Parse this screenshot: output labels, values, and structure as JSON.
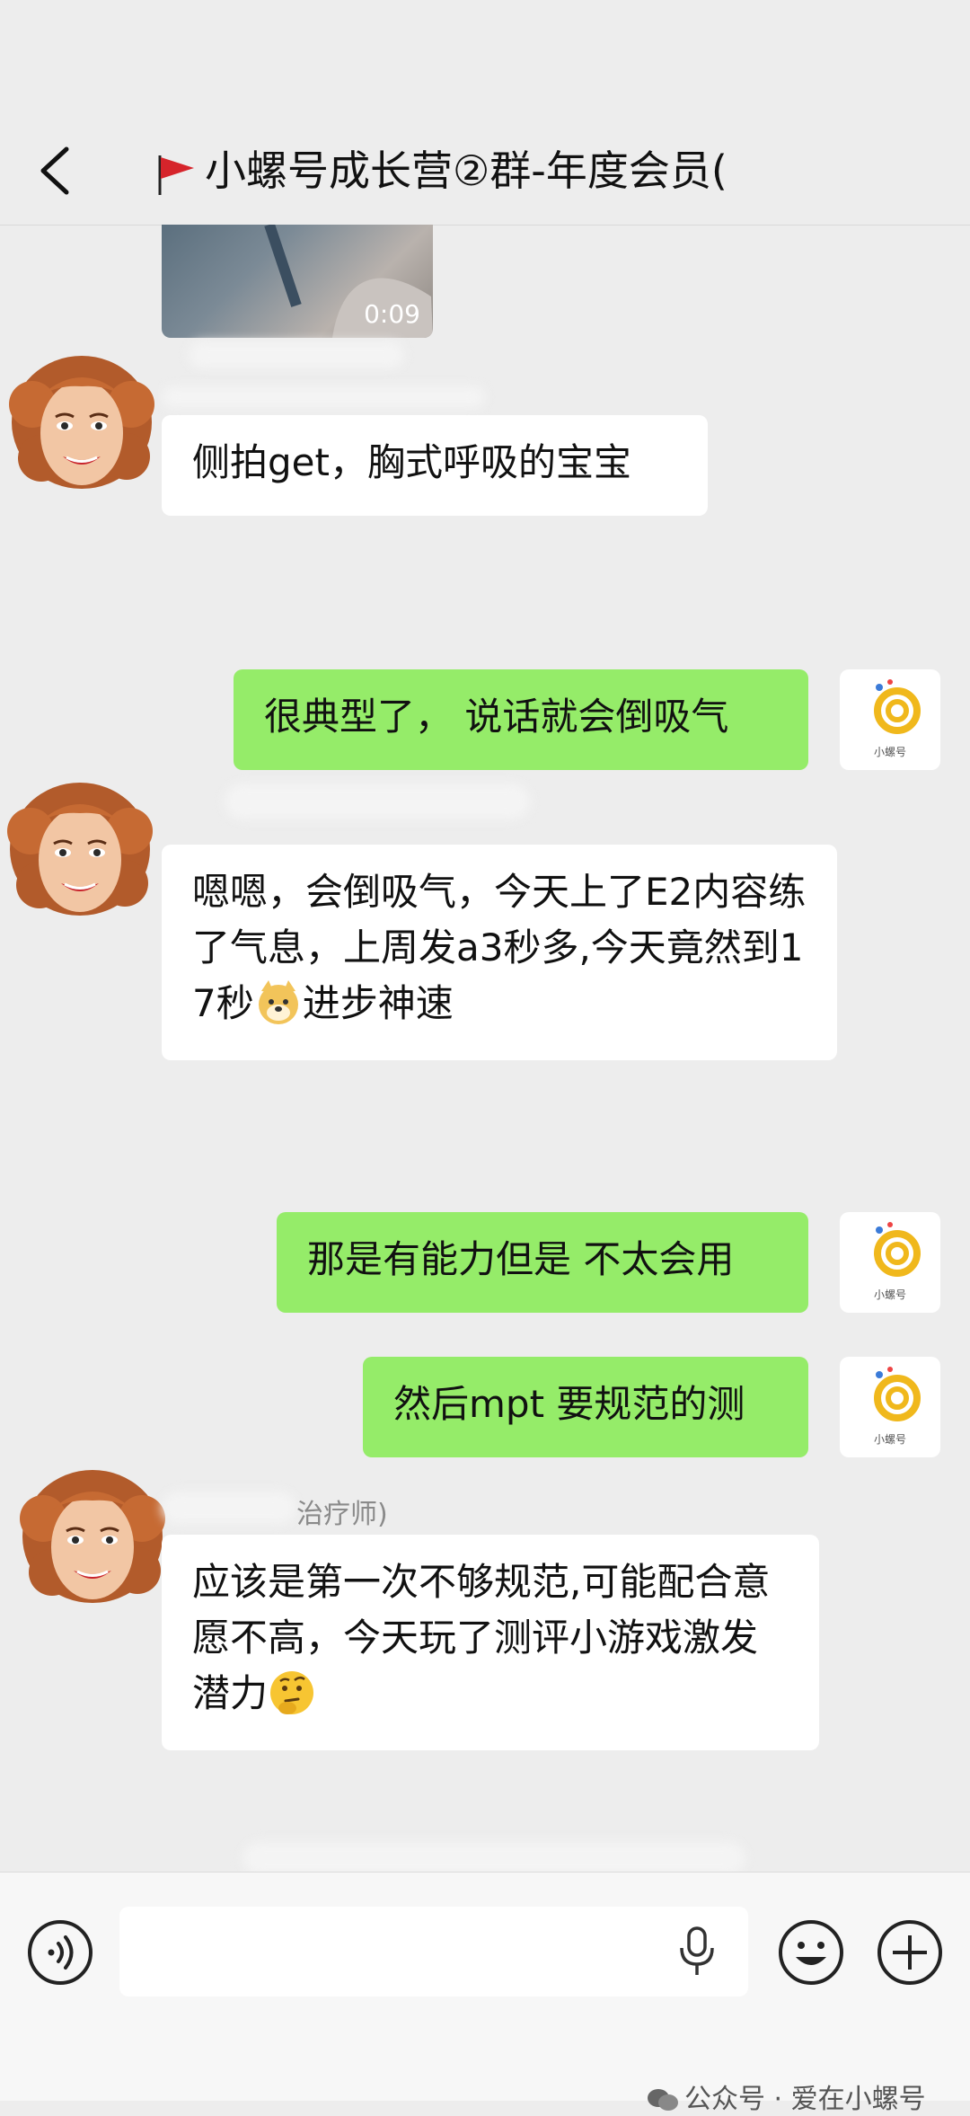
{
  "header": {
    "title": "小螺号成长营②群-年度会员(",
    "back_icon": "chevron-left-icon",
    "flag_icon": "red-flag-icon"
  },
  "video": {
    "duration": "0:09"
  },
  "messages": [
    {
      "side": "in",
      "text": "侧拍get，胸式呼吸的宝宝"
    },
    {
      "side": "out",
      "text": "很典型了， 说话就会倒吸气"
    },
    {
      "side": "in",
      "text_before": "嗯嗯，会倒吸气，今天上了E2内容练了气息，上周发a3秒多,今天竟然到17秒",
      "emoji": "doge-emoji",
      "text_after": "进步神速"
    },
    {
      "side": "out",
      "text": "那是有能力但是 不太会用"
    },
    {
      "side": "out",
      "text": "然后mpt 要规范的测"
    },
    {
      "side": "in",
      "sender": "治疗师)",
      "text_before": "应该是第一次不够规范,可能配合意愿不高，今天玩了测评小游戏激发潜力",
      "emoji": "thinking-face-emoji"
    }
  ],
  "input_bar": {
    "voice_icon": "voice-icon",
    "mic_icon": "mic-icon",
    "emoji_icon": "smiley-icon",
    "plus_icon": "plus-icon"
  },
  "watermark": "公众号 · 爱在小螺号",
  "colors": {
    "background": "#ededed",
    "outgoing": "#95ec69",
    "incoming": "#ffffff"
  }
}
